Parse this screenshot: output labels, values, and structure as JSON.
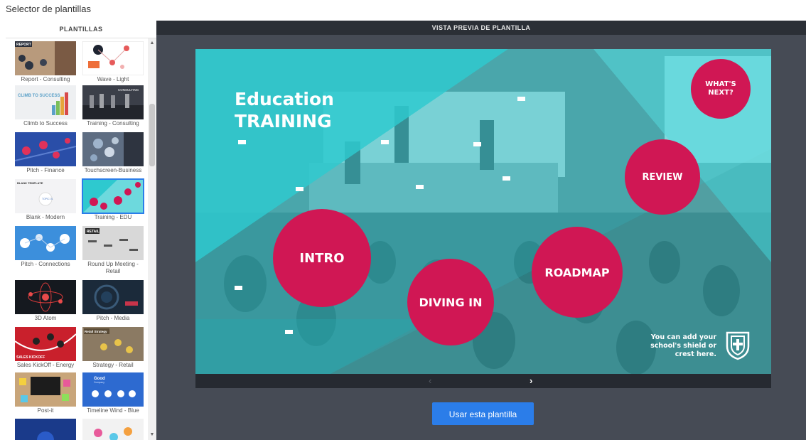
{
  "app": {
    "title": "Selector de plantillas"
  },
  "sidebar": {
    "header": "PLANTILLAS",
    "templates": [
      {
        "label": "Report - Consulting"
      },
      {
        "label": "Wave - Light"
      },
      {
        "label": "Climb to Success"
      },
      {
        "label": "Training - Consulting"
      },
      {
        "label": "Pitch - Finance"
      },
      {
        "label": "Touchscreen-Business"
      },
      {
        "label": "Blank - Modern"
      },
      {
        "label": "Training - EDU"
      },
      {
        "label": "Pitch - Connections"
      },
      {
        "label": "Round Up Meeting - Retail"
      },
      {
        "label": "3D Atom"
      },
      {
        "label": "Pitch - Media"
      },
      {
        "label": "Sales KickOff - Energy"
      },
      {
        "label": "Strategy - Retail"
      },
      {
        "label": "Post-it"
      },
      {
        "label": "Timeline Wind - Blue"
      },
      {
        "label": ""
      },
      {
        "label": ""
      }
    ],
    "thumb_text": {
      "report": "REPORT",
      "climb": "CLIMB TO SUCCESS",
      "consulting": "CONSULTING",
      "blank": "BLANK TEMPLATE",
      "blank_topic": "TOPIC 01",
      "retail": "RETAIL",
      "sales": "SALES KICKOFF",
      "strategy": "Retail Strategy",
      "good": "Good",
      "good_sub": "Company"
    }
  },
  "preview": {
    "header": "VISTA PREVIA DE PLANTILLA",
    "slide": {
      "title_line1": "Education",
      "title_line2": "TRAINING",
      "circles": {
        "intro": "INTRO",
        "diving": "DIVING IN",
        "roadmap": "ROADMAP",
        "review": "REVIEW",
        "whats_next_1": "WHAT'S",
        "whats_next_2": "NEXT?"
      },
      "shield_text_1": "You can add your",
      "shield_text_2": "school's shield or",
      "shield_text_3": "crest here."
    },
    "nav": {
      "prev": "‹",
      "next": "›"
    },
    "use_button": "Usar esta plantilla"
  },
  "colors": {
    "accent": "#2b7de9",
    "circle": "#d01754",
    "teal": "#2ec9cf"
  }
}
